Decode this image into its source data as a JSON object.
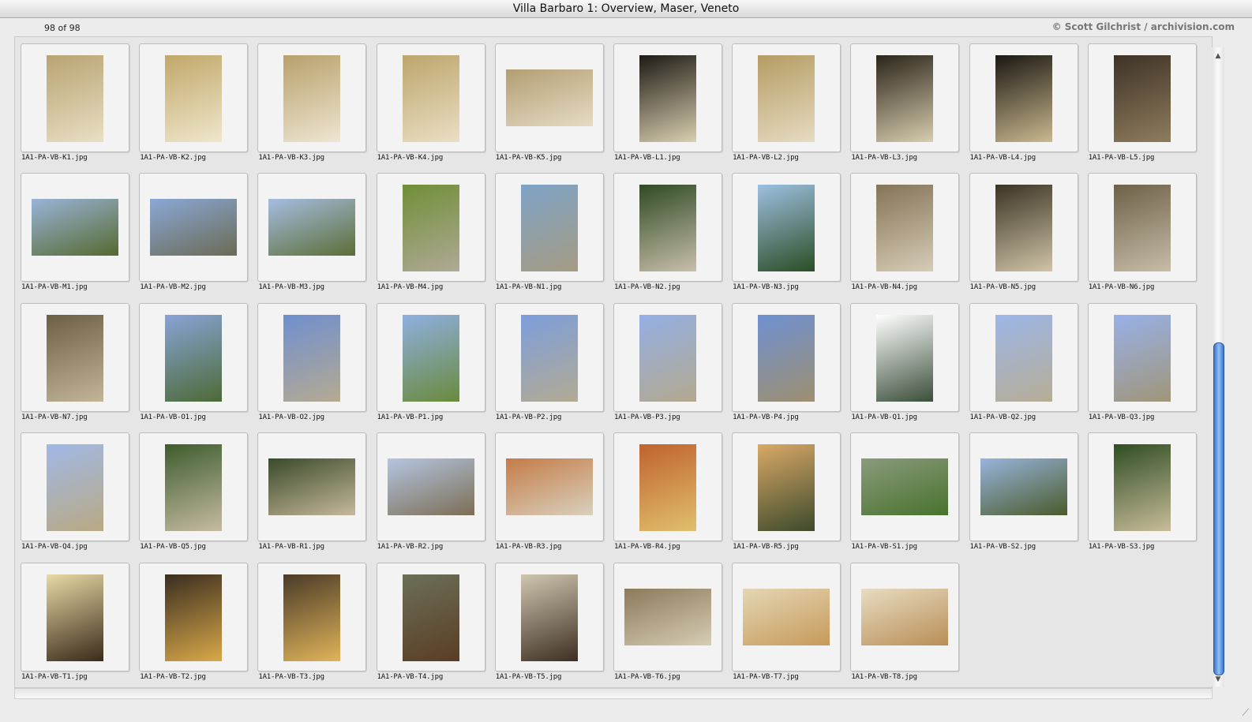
{
  "window": {
    "title": "Villa Barbaro 1: Overview, Maser, Veneto",
    "count": "98 of 98",
    "credit": "© Scott Gilchrist / archivision.com"
  },
  "thumbnails": [
    {
      "filename": "1A1-PA-VB-K1.jpg",
      "orientation": "portrait",
      "colors": [
        "#b9a371",
        "#e8dfc5"
      ]
    },
    {
      "filename": "1A1-PA-VB-K2.jpg",
      "orientation": "portrait",
      "colors": [
        "#c1a86a",
        "#efe6cc"
      ]
    },
    {
      "filename": "1A1-PA-VB-K3.jpg",
      "orientation": "portrait",
      "colors": [
        "#b8a06b",
        "#eee6d2"
      ]
    },
    {
      "filename": "1A1-PA-VB-K4.jpg",
      "orientation": "portrait",
      "colors": [
        "#bda56c",
        "#eadfc4"
      ]
    },
    {
      "filename": "1A1-PA-VB-K5.jpg",
      "orientation": "landscape",
      "colors": [
        "#b29e73",
        "#e6dcc4"
      ]
    },
    {
      "filename": "1A1-PA-VB-L1.jpg",
      "orientation": "portrait",
      "colors": [
        "#1d1a14",
        "#d9ceb0"
      ]
    },
    {
      "filename": "1A1-PA-VB-L2.jpg",
      "orientation": "portrait",
      "colors": [
        "#b59c63",
        "#e6dbc2"
      ]
    },
    {
      "filename": "1A1-PA-VB-L3.jpg",
      "orientation": "portrait",
      "colors": [
        "#2a241a",
        "#d8cdae"
      ]
    },
    {
      "filename": "1A1-PA-VB-L4.jpg",
      "orientation": "portrait",
      "colors": [
        "#1b1712",
        "#c9b98f"
      ]
    },
    {
      "filename": "1A1-PA-VB-L5.jpg",
      "orientation": "portrait",
      "colors": [
        "#3d3226",
        "#8e7c5d"
      ]
    },
    {
      "filename": "1A1-PA-VB-M1.jpg",
      "orientation": "landscape",
      "colors": [
        "#9ab4d8",
        "#55692f"
      ]
    },
    {
      "filename": "1A1-PA-VB-M2.jpg",
      "orientation": "landscape",
      "colors": [
        "#8aa8d6",
        "#6b6a55"
      ]
    },
    {
      "filename": "1A1-PA-VB-M3.jpg",
      "orientation": "landscape",
      "colors": [
        "#a6bde0",
        "#5b6e37"
      ]
    },
    {
      "filename": "1A1-PA-VB-M4.jpg",
      "orientation": "portrait",
      "colors": [
        "#6f8f37",
        "#b0a996"
      ]
    },
    {
      "filename": "1A1-PA-VB-N1.jpg",
      "orientation": "portrait",
      "colors": [
        "#7ea3c6",
        "#a59b83"
      ]
    },
    {
      "filename": "1A1-PA-VB-N2.jpg",
      "orientation": "portrait",
      "colors": [
        "#2f4a24",
        "#c8bfaa"
      ]
    },
    {
      "filename": "1A1-PA-VB-N3.jpg",
      "orientation": "portrait",
      "colors": [
        "#9dc0e2",
        "#2b4d24"
      ]
    },
    {
      "filename": "1A1-PA-VB-N4.jpg",
      "orientation": "portrait",
      "colors": [
        "#857457",
        "#d6ccb6"
      ]
    },
    {
      "filename": "1A1-PA-VB-N5.jpg",
      "orientation": "portrait",
      "colors": [
        "#3b3323",
        "#cfc4a8"
      ]
    },
    {
      "filename": "1A1-PA-VB-N6.jpg",
      "orientation": "portrait",
      "colors": [
        "#6e6148",
        "#c7bda7"
      ]
    },
    {
      "filename": "1A1-PA-VB-N7.jpg",
      "orientation": "portrait",
      "colors": [
        "#6d5f45",
        "#c2b697"
      ]
    },
    {
      "filename": "1A1-PA-VB-O1.jpg",
      "orientation": "portrait",
      "colors": [
        "#87a4d6",
        "#4d6a37"
      ]
    },
    {
      "filename": "1A1-PA-VB-O2.jpg",
      "orientation": "portrait",
      "colors": [
        "#6f8fcf",
        "#b5aa92"
      ]
    },
    {
      "filename": "1A1-PA-VB-P1.jpg",
      "orientation": "portrait",
      "colors": [
        "#8eb0e0",
        "#6a8a3d"
      ]
    },
    {
      "filename": "1A1-PA-VB-P2.jpg",
      "orientation": "portrait",
      "colors": [
        "#7c9edb",
        "#b3aa94"
      ]
    },
    {
      "filename": "1A1-PA-VB-P3.jpg",
      "orientation": "portrait",
      "colors": [
        "#94b0e4",
        "#b3a88f"
      ]
    },
    {
      "filename": "1A1-PA-VB-P4.jpg",
      "orientation": "portrait",
      "colors": [
        "#6f91d2",
        "#9d8f70"
      ]
    },
    {
      "filename": "1A1-PA-VB-Q1.jpg",
      "orientation": "portrait",
      "colors": [
        "#ffffff",
        "#3a4e3a"
      ]
    },
    {
      "filename": "1A1-PA-VB-Q2.jpg",
      "orientation": "portrait",
      "colors": [
        "#9cb6e8",
        "#b7ad95"
      ]
    },
    {
      "filename": "1A1-PA-VB-Q3.jpg",
      "orientation": "portrait",
      "colors": [
        "#98b1e8",
        "#a09579"
      ]
    },
    {
      "filename": "1A1-PA-VB-Q4.jpg",
      "orientation": "portrait",
      "colors": [
        "#a0b8e6",
        "#b9a983"
      ]
    },
    {
      "filename": "1A1-PA-VB-Q5.jpg",
      "orientation": "portrait",
      "colors": [
        "#3d5c2c",
        "#c6bba2"
      ]
    },
    {
      "filename": "1A1-PA-VB-R1.jpg",
      "orientation": "landscape",
      "colors": [
        "#3a4a2a",
        "#c5b89a"
      ]
    },
    {
      "filename": "1A1-PA-VB-R2.jpg",
      "orientation": "landscape",
      "colors": [
        "#b4c5e0",
        "#7c6e55"
      ]
    },
    {
      "filename": "1A1-PA-VB-R3.jpg",
      "orientation": "landscape",
      "colors": [
        "#c47c48",
        "#d9d0bd"
      ]
    },
    {
      "filename": "1A1-PA-VB-R4.jpg",
      "orientation": "portrait",
      "colors": [
        "#c0622f",
        "#e0c06c"
      ]
    },
    {
      "filename": "1A1-PA-VB-R5.jpg",
      "orientation": "portrait",
      "colors": [
        "#d9a967",
        "#3d4a2c"
      ]
    },
    {
      "filename": "1A1-PA-VB-S1.jpg",
      "orientation": "landscape",
      "colors": [
        "#8a9b7b",
        "#48722e"
      ]
    },
    {
      "filename": "1A1-PA-VB-S2.jpg",
      "orientation": "landscape",
      "colors": [
        "#98b4dc",
        "#4a5b2c"
      ]
    },
    {
      "filename": "1A1-PA-VB-S3.jpg",
      "orientation": "portrait",
      "colors": [
        "#2f4d22",
        "#c8bc9a"
      ]
    },
    {
      "filename": "1A1-PA-VB-T1.jpg",
      "orientation": "portrait",
      "colors": [
        "#e8d9a6",
        "#3a2a1a"
      ]
    },
    {
      "filename": "1A1-PA-VB-T2.jpg",
      "orientation": "portrait",
      "colors": [
        "#3a2d1f",
        "#d9a94a"
      ]
    },
    {
      "filename": "1A1-PA-VB-T3.jpg",
      "orientation": "portrait",
      "colors": [
        "#4a3a27",
        "#e0b45a"
      ]
    },
    {
      "filename": "1A1-PA-VB-T4.jpg",
      "orientation": "portrait",
      "colors": [
        "#6c6f58",
        "#5a3d24"
      ]
    },
    {
      "filename": "1A1-PA-VB-T5.jpg",
      "orientation": "portrait",
      "colors": [
        "#cfc6b0",
        "#3d2f22"
      ]
    },
    {
      "filename": "1A1-PA-VB-T6.jpg",
      "orientation": "landscape",
      "colors": [
        "#8c7a5a",
        "#d6cdb5"
      ]
    },
    {
      "filename": "1A1-PA-VB-T7.jpg",
      "orientation": "landscape",
      "colors": [
        "#e4d6b4",
        "#c79a5a"
      ]
    },
    {
      "filename": "1A1-PA-VB-T8.jpg",
      "orientation": "landscape",
      "colors": [
        "#e8dcc2",
        "#b88e56"
      ]
    }
  ],
  "scrollbar": {
    "arrow_up": "▲",
    "arrow_down": "▼"
  },
  "resize_grip": "⟋"
}
